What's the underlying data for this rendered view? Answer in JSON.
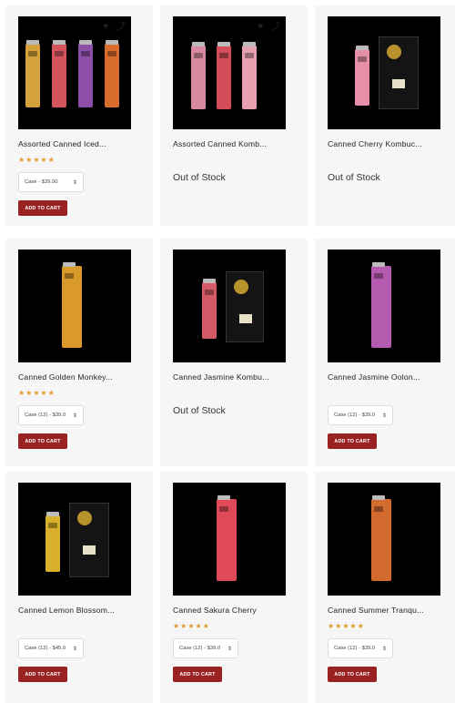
{
  "products": [
    {
      "title": "Assorted Canned Iced...",
      "stars": "★★★★★",
      "stock": "in",
      "select": "Case - $39.00",
      "button": "ADD TO CART",
      "icons": "heart-icon share-icon",
      "colors": [
        "#d4a23a",
        "#d6545c",
        "#8b4fa8",
        "#d96d2e"
      ]
    },
    {
      "title": "Assorted Canned Komb...",
      "stars": "",
      "stock": "out",
      "status": "Out of Stock",
      "icons": "heart-icon share-icon",
      "colors": [
        "#d98aa0",
        "#d34d5a",
        "#e6a0b0"
      ]
    },
    {
      "title": "Canned Cherry Kombuc...",
      "stars": "",
      "stock": "out",
      "status": "Out of Stock",
      "colors": [
        "#e58fa8"
      ]
    },
    {
      "title": "Canned Golden Monkey...",
      "stars": "★★★★★",
      "stock": "in",
      "select": "Case (12) - $39.0",
      "button": "ADD TO CART",
      "colors": [
        "#d99a2b"
      ]
    },
    {
      "title": "Canned Jasmine Kombu...",
      "stars": "",
      "stock": "out",
      "status": "Out of Stock",
      "colors": [
        "#d45a68"
      ]
    },
    {
      "title": "Canned Jasmine Oolon...",
      "stars": "",
      "stock": "in",
      "select": "Case (12) - $39.0",
      "button": "ADD TO CART",
      "colors": [
        "#b45bb0"
      ]
    },
    {
      "title": "Canned Lemon Blossom...",
      "stars": "",
      "stock": "in",
      "select": "Case (12) - $45.0",
      "button": "ADD TO CART",
      "colors": [
        "#d9b02c"
      ]
    },
    {
      "title": "Canned Sakura Cherry",
      "stars": "★★★★★",
      "stock": "in",
      "select": "Case (12) - $39.0",
      "button": "ADD TO CART",
      "colors": [
        "#e04a58"
      ]
    },
    {
      "title": "Canned Summer Tranqu...",
      "stars": "★★★★★",
      "stock": "in",
      "select": "Case (12) - $39.0",
      "button": "ADD TO CART",
      "colors": [
        "#d36a2e"
      ]
    }
  ],
  "theme": {
    "button_color": "#9b2222",
    "star_color": "#e09a2a",
    "card_bg": "#f6f6f6"
  }
}
